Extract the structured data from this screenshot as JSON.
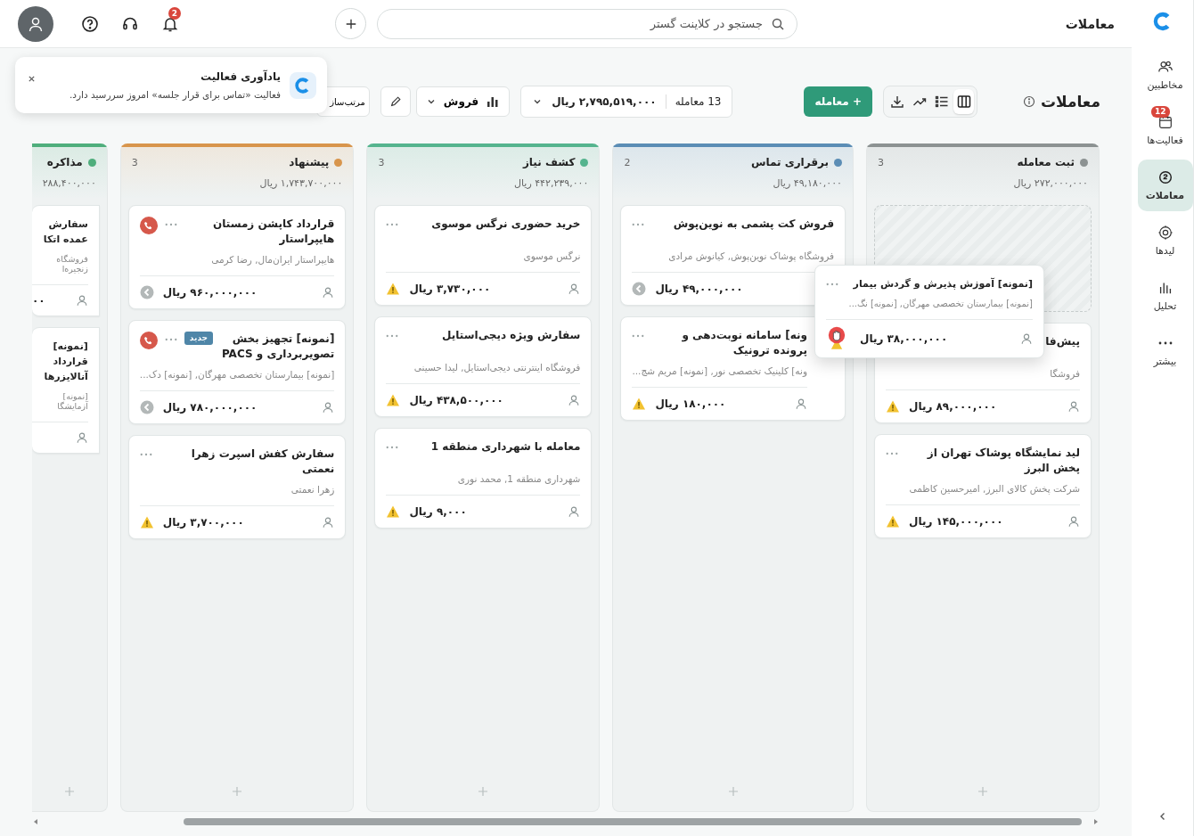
{
  "topbar": {
    "title": "معاملات",
    "search": {
      "placeholder": "جستجو در کلاینت گستر"
    },
    "notifications_badge": "2"
  },
  "sidebar": {
    "items": [
      {
        "kind": "contacts",
        "label": "مخاطبین",
        "selected": false
      },
      {
        "kind": "activities",
        "label": "فعالیت‌ها",
        "badge": "12",
        "selected": false
      },
      {
        "kind": "deals",
        "label": "معاملات",
        "selected": true
      },
      {
        "kind": "leads",
        "label": "لیدها",
        "selected": false
      },
      {
        "kind": "analytics",
        "label": "تحلیل",
        "selected": false
      },
      {
        "kind": "more",
        "label": "بیشتر",
        "selected": false
      }
    ]
  },
  "notification": {
    "title": "یادآوری فعالیت",
    "message": "فعالیت «تماس برای قرار جلسه» امروز سررسید دارد."
  },
  "toolbar": {
    "title": "معاملات",
    "views": [
      {
        "kind": "kanban",
        "selected": true
      },
      {
        "kind": "list",
        "selected": false
      },
      {
        "kind": "chart",
        "selected": false
      }
    ],
    "new_button": "+ معامله",
    "summary": {
      "count": "13 معامله",
      "total": "۲,۷۹۵,۵۱۹,۰۰۰ ریال"
    },
    "pipeline": "فروش",
    "sort_button": "مرتب‌ساز"
  },
  "columns": [
    {
      "name": "ثبت معامله",
      "count": "3",
      "total": "۲۷۲,۰۰۰,۰۰۰ ریال",
      "color": "#8c9292",
      "cards": [
        {
          "kind": "placeholder"
        },
        {
          "kind": "deal",
          "title": "پیش‌فا",
          "subtitle": "فروشگا",
          "amount": "۸۹,۰۰۰,۰۰۰ ریال",
          "stalled": false,
          "call": false,
          "more_menu": false,
          "owner_icon": true
        },
        {
          "kind": "deal",
          "title": "لید نمایشگاه پوشاک تهران از پخش البرز",
          "subtitle": "شرکت پخش کالای البرز, امیرحسین کاظمی",
          "amount": "۱۴۵,۰۰۰,۰۰۰ ریال",
          "stalled": false,
          "call": false,
          "more_menu": true,
          "owner_icon": true
        }
      ]
    },
    {
      "name": "برقراری تماس",
      "count": "2",
      "total": "۴۹,۱۸۰,۰۰۰ ریال",
      "color": "#5b8db5",
      "cards": [
        {
          "kind": "deal",
          "title": "فروش کت پشمی به نوین‌پوش",
          "subtitle": "فروشگاه پوشاک نوین‌پوش, کیانوش مرادی",
          "amount": "۴۹,۰۰۰,۰۰۰ ریال",
          "stalled": true,
          "call": false,
          "more_menu": true,
          "owner_icon": false
        },
        {
          "kind": "partly-hidden",
          "title": "ونه] سامانه نوبت‌دهی و پرونده ترونیک",
          "subtitle": "ونه] کلینیک تخصصی نور, [نمونه] مریم شج...",
          "amount": "۱۸۰,۰۰۰ ریال",
          "stalled": false,
          "call": false,
          "more_menu": true,
          "owner_icon": true
        }
      ]
    },
    {
      "name": "کشف نیاز",
      "count": "3",
      "total": "۴۴۲,۲۳۹,۰۰۰ ریال",
      "color": "#55b48e",
      "cards": [
        {
          "kind": "deal",
          "title": "خرید حضوری نرگس موسوی",
          "subtitle": "نرگس موسوی",
          "amount": "۳,۷۳۰,۰۰۰ ریال",
          "stalled": false,
          "call": false,
          "more_menu": true,
          "owner_icon": true
        },
        {
          "kind": "deal",
          "title": "سفارش ویژه دیجی‌استایل",
          "subtitle": "فروشگاه اینترنتی دیجی‌استایل, لیدا حسینی",
          "amount": "۴۳۸,۵۰۰,۰۰۰ ریال",
          "stalled": false,
          "call": false,
          "more_menu": true,
          "owner_icon": true
        },
        {
          "kind": "deal",
          "title": "معامله با شهرداری منطقه 1",
          "subtitle": "شهرداری منطقه 1, محمد نوری",
          "amount": "۹,۰۰۰ ریال",
          "stalled": false,
          "call": false,
          "more_menu": true,
          "owner_icon": true
        }
      ]
    },
    {
      "name": "پیشنهاد",
      "count": "3",
      "total": "۱,۷۴۳,۷۰۰,۰۰۰ ریال",
      "color": "#d8954c",
      "cards": [
        {
          "kind": "deal",
          "title": "قرارداد کاپشن زمستان هایپراستار",
          "subtitle": "هایپراستار ایران‌مال, رضا کرمی",
          "amount": "۹۶۰,۰۰۰,۰۰۰ ریال",
          "stalled": true,
          "call": true,
          "more_menu": true,
          "owner_icon": true
        },
        {
          "kind": "deal",
          "title": "[نمونه] تجهیز بخش تصویربرداری و PACS",
          "badge": "جدید",
          "subtitle": "[نمونه] بیمارستان تخصصی مهرگان, [نمونه] دک...",
          "amount": "۷۸۰,۰۰۰,۰۰۰ ریال",
          "stalled": true,
          "call": true,
          "more_menu": true,
          "owner_icon": true
        },
        {
          "kind": "deal",
          "title": "سفارش کفش اسپرت زهرا نعمتی",
          "subtitle": "زهرا نعمتی",
          "amount": "۳,۷۰۰,۰۰۰ ریال",
          "stalled": false,
          "call": false,
          "more_menu": true,
          "owner_icon": true
        }
      ]
    },
    {
      "name": "مذاکره",
      "total": "۲۸۸,۴۰۰,۰۰۰",
      "color": "#4fae7c",
      "cards": [
        {
          "kind": "deal",
          "title": "سفارش عمده اتکا",
          "subtitle": "فروشگاه زنجیره‌ا",
          "amount": "۰۰",
          "call": false,
          "more_menu": false,
          "owner_icon": true
        },
        {
          "kind": "deal",
          "title": "[نمونه] قرارداد آنالایزرها",
          "subtitle": "[نمونه] آزمایشگا",
          "call": false,
          "more_menu": false,
          "owner_icon": true
        }
      ]
    }
  ],
  "drag_card": {
    "title": "[نمونه] آموزش پذیرش و گردش بیمار",
    "subtitle": "[نمونه] بیمارستان تخصصی مهرگان, [نمونه] نگ...",
    "amount": "۳۸,۰۰۰,۰۰۰ ریال"
  }
}
